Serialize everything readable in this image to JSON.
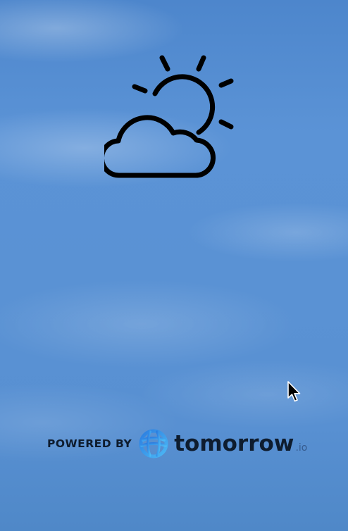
{
  "weather": {
    "icon": "partly-cloudy-icon"
  },
  "branding": {
    "powered_by": "POWERED BY",
    "logo_icon": "tomorrow-io-logo-icon",
    "name": "tomorrow",
    "tld": ".io"
  },
  "cursor": {
    "icon": "mouse-pointer-icon"
  },
  "colors": {
    "sky": "#5a92d4",
    "icon_stroke": "#000000",
    "brand_text": "#0e1c2e",
    "logo_blue": "#3aa0f0"
  }
}
